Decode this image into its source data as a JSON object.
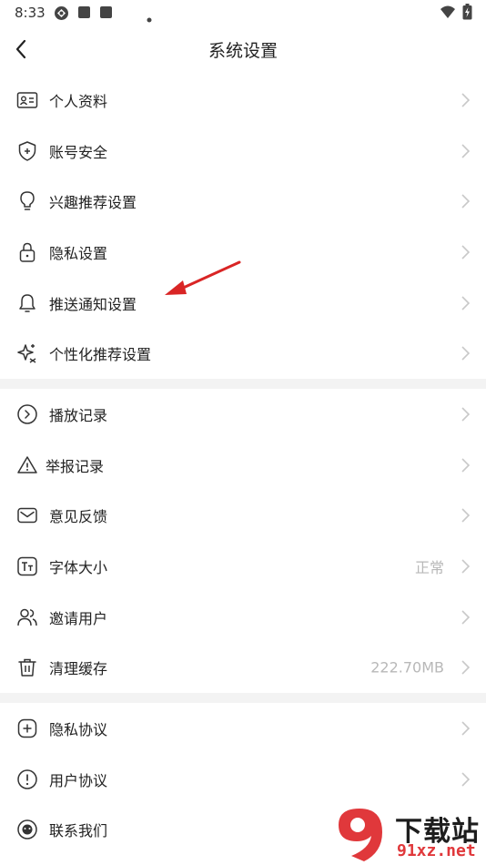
{
  "status_bar": {
    "time": "8:33"
  },
  "header": {
    "title": "系统设置"
  },
  "group1": [
    {
      "label": "个人资料",
      "icon": "profile-card-icon"
    },
    {
      "label": "账号安全",
      "icon": "shield-icon"
    },
    {
      "label": "兴趣推荐设置",
      "icon": "lightbulb-icon"
    },
    {
      "label": "隐私设置",
      "icon": "lock-icon"
    },
    {
      "label": "推送通知设置",
      "icon": "bell-icon"
    },
    {
      "label": "个性化推荐设置",
      "icon": "sparkle-icon"
    }
  ],
  "group2": [
    {
      "label": "播放记录",
      "icon": "play-circle-icon"
    },
    {
      "label": "举报记录",
      "icon": "warning-icon"
    },
    {
      "label": "意见反馈",
      "icon": "mail-icon"
    },
    {
      "label": "字体大小",
      "icon": "font-size-icon",
      "value": "正常"
    },
    {
      "label": "邀请用户",
      "icon": "users-icon"
    },
    {
      "label": "清理缓存",
      "icon": "trash-icon",
      "value": "222.70MB"
    }
  ],
  "group3": [
    {
      "label": "隐私协议",
      "icon": "plus-square-icon"
    },
    {
      "label": "用户协议",
      "icon": "info-circle-icon"
    },
    {
      "label": "联系我们",
      "icon": "chat-bubble-icon"
    }
  ],
  "watermark": {
    "text_cn": "下载站",
    "text_en": "91xz.net"
  },
  "colors": {
    "annotation_arrow": "#d92525",
    "chevron": "#c8c8c8",
    "divider": "#f3f3f3"
  }
}
